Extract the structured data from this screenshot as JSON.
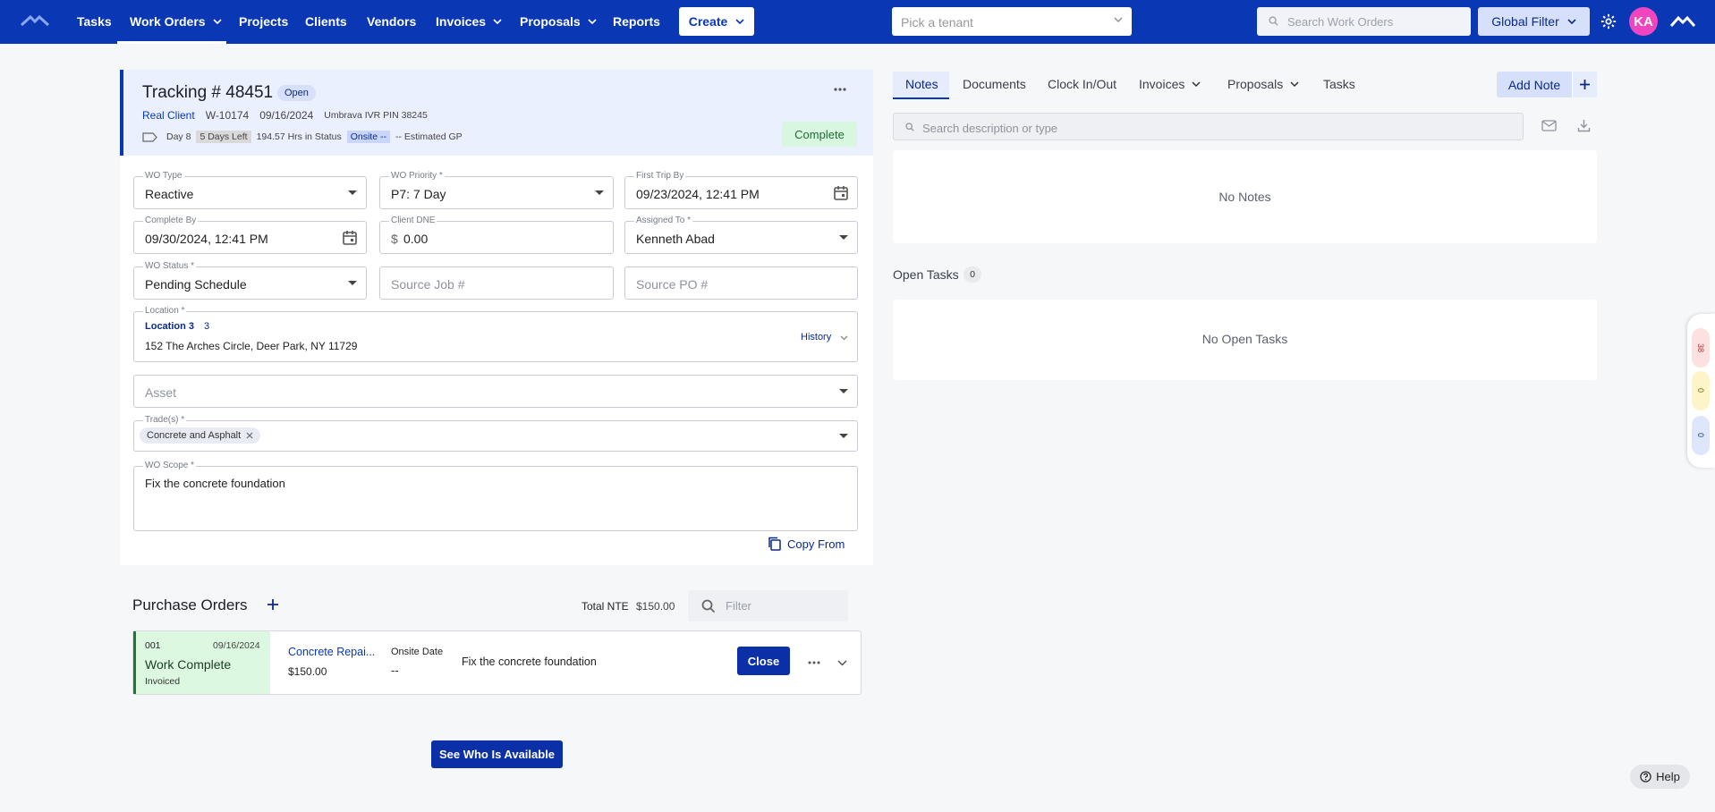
{
  "nav": {
    "items": [
      "Tasks",
      "Work Orders",
      "Projects",
      "Clients",
      "Vendors",
      "Invoices",
      "Proposals",
      "Reports"
    ],
    "create_label": "Create",
    "tenant_placeholder": "Pick a tenant",
    "search_placeholder": "Search Work Orders",
    "global_filter_label": "Global Filter",
    "avatar_initials": "KA"
  },
  "work_order": {
    "tracking_label": "Tracking # 48451",
    "status_badge": "Open",
    "client_name": "Real Client",
    "wo_number": "W-10174",
    "date": "09/16/2024",
    "ivr_pin": "Umbrava IVR PIN 38245",
    "day_label": "Day 8",
    "days_left": "5 Days Left",
    "hrs_in_status": "194.57 Hrs in Status",
    "onsite_badge": "Onsite --",
    "estimated_gp": "-- Estimated GP",
    "complete_button": "Complete"
  },
  "fields": {
    "wo_type": {
      "label": "WO Type",
      "value": "Reactive"
    },
    "wo_priority": {
      "label": "WO Priority *",
      "value": "P7: 7 Day"
    },
    "first_trip_by": {
      "label": "First Trip By",
      "value": "09/23/2024, 12:41 PM"
    },
    "complete_by": {
      "label": "Complete By",
      "value": "09/30/2024, 12:41 PM"
    },
    "client_dne": {
      "label": "Client DNE",
      "currency": "$",
      "value": "0.00"
    },
    "assigned_to": {
      "label": "Assigned To *",
      "value": "Kenneth Abad"
    },
    "wo_status": {
      "label": "WO Status *",
      "value": "Pending Schedule"
    },
    "source_job": {
      "placeholder": "Source Job #"
    },
    "source_po": {
      "placeholder": "Source PO #"
    },
    "location": {
      "label": "Location *",
      "name": "Location 3",
      "number": "3",
      "address": "152 The Arches Circle, Deer Park, NY 11729",
      "history_label": "History"
    },
    "asset": {
      "placeholder": "Asset"
    },
    "trades": {
      "label": "Trade(s) *",
      "chip": "Concrete and Asphalt"
    },
    "wo_scope": {
      "label": "WO Scope *",
      "value": "Fix the concrete foundation"
    },
    "copy_from_label": "Copy From"
  },
  "purchase_orders": {
    "title": "Purchase Orders",
    "total_nte_label": "Total NTE",
    "total_nte_value": "$150.00",
    "filter_placeholder": "Filter",
    "rows": [
      {
        "number": "001",
        "date": "09/16/2024",
        "status": "Work Complete",
        "substatus": "Invoiced",
        "vendor": "Concrete Repai...",
        "amount": "$150.00",
        "onsite_label": "Onsite Date",
        "onsite_value": "--",
        "description": "Fix the concrete foundation",
        "close_label": "Close"
      }
    ],
    "see_who_label": "See Who Is Available"
  },
  "right": {
    "tabs": [
      "Notes",
      "Documents",
      "Clock In/Out",
      "Invoices",
      "Proposals",
      "Tasks"
    ],
    "add_note_label": "Add Note",
    "search_placeholder": "Search description or type",
    "no_notes": "No Notes",
    "open_tasks_label": "Open Tasks",
    "open_tasks_count": "0",
    "no_open_tasks": "No Open Tasks"
  },
  "side_counts": [
    "38",
    "0",
    "0"
  ],
  "help_label": "Help",
  "colors": {
    "nav_bg": "#0a38b5",
    "accent": "#0b2fa6",
    "complete_green": "#d9f7e0",
    "avatar": "#ef46c0"
  }
}
